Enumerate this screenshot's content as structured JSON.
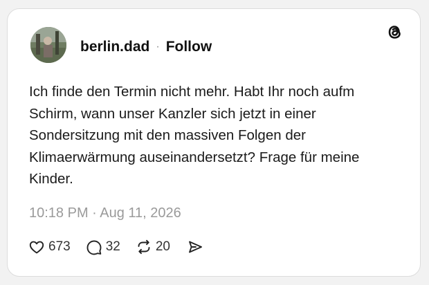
{
  "post": {
    "username": "berlin.dad",
    "separator": "·",
    "follow_label": "Follow",
    "text": "Ich finde den Termin nicht mehr. Habt Ihr noch aufm Schirm, wann unser Kanzler sich jetzt in einer Sondersitzung mit den massiven Folgen der Klimaerwärmung auseinandersetzt? Frage für meine Kinder.",
    "timestamp": "10:18 PM · Aug 11, 2026",
    "likes": "673",
    "replies": "32",
    "reposts": "20"
  },
  "icons": {
    "brand": "threads-logo-icon",
    "like": "heart-icon",
    "reply": "comment-icon",
    "repost": "repost-icon",
    "share": "send-icon"
  },
  "colors": {
    "text": "#111111",
    "muted": "#9a9a9a",
    "card_background": "#ffffff",
    "card_border": "#dcdcdc"
  }
}
